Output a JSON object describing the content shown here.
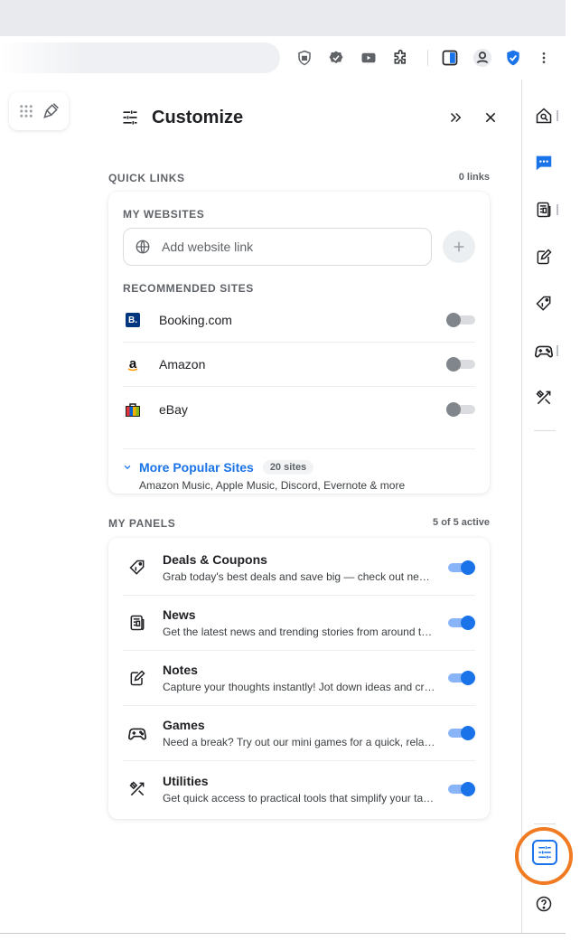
{
  "colors": {
    "accent": "#1a73e8",
    "highlight": "#f07b22",
    "toggle_off": "#80868b"
  },
  "browser": {
    "toolbar_icons": [
      "shield-lock-icon",
      "shield-check-icon",
      "youtube-icon",
      "extensions-icon",
      "sidebar-icon",
      "profile-icon",
      "security-shield-icon",
      "more-vert-icon"
    ]
  },
  "panel": {
    "title": "Customize",
    "header_icons": [
      "sliders-icon",
      "collapse-icon",
      "close-icon"
    ],
    "quick_links": {
      "label": "QUICK LINKS",
      "count": "0 links",
      "my_websites_label": "MY WEBSITES",
      "add_placeholder": "Add website link",
      "recommended_label": "RECOMMENDED SITES",
      "sites": [
        {
          "name": "Booking.com",
          "logo_text": "B.",
          "enabled": false
        },
        {
          "name": "Amazon",
          "logo_text": "a",
          "enabled": false
        },
        {
          "name": "eBay",
          "logo_text": "",
          "enabled": false
        }
      ],
      "more": {
        "title": "More Popular Sites",
        "badge": "20 sites",
        "desc": "Amazon Music, Apple Music, Discord, Evernote & more"
      }
    },
    "my_panels": {
      "label": "MY PANELS",
      "count": "5 of 5 active",
      "items": [
        {
          "title": "Deals & Coupons",
          "desc": "Grab today's best deals and save big — check out new offers every day",
          "icon": "tag-icon",
          "enabled": true
        },
        {
          "title": "News",
          "desc": "Get the latest news and trending stories from around the world",
          "icon": "newspaper-icon",
          "enabled": true
        },
        {
          "title": "Notes",
          "desc": "Capture your thoughts instantly! Jot down ideas and create quick notes",
          "icon": "notes-icon",
          "enabled": true
        },
        {
          "title": "Games",
          "desc": "Need a break? Try out our mini games for a quick, relaxing session",
          "icon": "gamepad-icon",
          "enabled": true
        },
        {
          "title": "Utilities",
          "desc": "Get quick access to practical tools that simplify your tasks",
          "icon": "tools-icon",
          "enabled": true
        }
      ]
    }
  },
  "rail": {
    "icons": [
      "search-home-icon",
      "chat-icon",
      "news-icon",
      "notes-icon",
      "tag-icon",
      "gamepad-icon",
      "tools-icon"
    ],
    "bottom_icons": [
      "customize-icon",
      "help-icon"
    ]
  }
}
